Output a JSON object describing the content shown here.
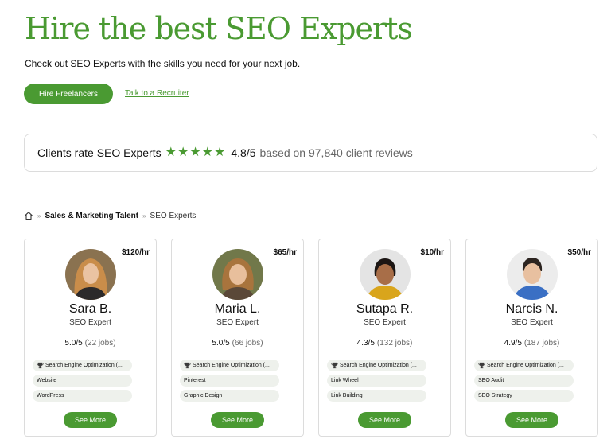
{
  "header": {
    "title": "Hire the best SEO Experts",
    "subtitle": "Check out SEO Experts with the skills you need for your next job.",
    "hire_button": "Hire Freelancers",
    "recruiter_link": "Talk to a Recruiter"
  },
  "rating": {
    "label": "Clients rate SEO Experts",
    "stars": 5,
    "score": "4.8/5",
    "reviews": "based on 97,840 client reviews"
  },
  "breadcrumb": {
    "home_icon": "home-icon",
    "parent": "Sales & Marketing Talent",
    "current": "SEO Experts"
  },
  "freelancers": [
    {
      "rate": "$120/hr",
      "name": "Sara B.",
      "role": "SEO Expert",
      "score": "5.0/5",
      "jobs": "(22 jobs)",
      "skills": [
        "Search Engine Optimization (...",
        "Website",
        "WordPress"
      ],
      "button": "See More",
      "avatar": {
        "bg": "#8a7250",
        "hair": "#c98d4a",
        "skin": "#eac3a2",
        "shirt": "#2c2a2a"
      }
    },
    {
      "rate": "$65/hr",
      "name": "Maria L.",
      "role": "SEO Expert",
      "score": "5.0/5",
      "jobs": "(66 jobs)",
      "skills": [
        "Search Engine Optimization (...",
        "Pinterest",
        "Graphic Design"
      ],
      "button": "See More",
      "avatar": {
        "bg": "#71784a",
        "hair": "#a8743d",
        "skin": "#e8bf9c",
        "shirt": "#5a4838"
      }
    },
    {
      "rate": "$10/hr",
      "name": "Sutapa R.",
      "role": "SEO Expert",
      "score": "4.3/5",
      "jobs": "(132 jobs)",
      "skills": [
        "Search Engine Optimization (...",
        "Link Wheel",
        "Link Building"
      ],
      "button": "See More",
      "avatar": {
        "bg": "#e4e4e4",
        "hair": "#1c1614",
        "skin": "#a86e48",
        "shirt": "#d9a51c"
      }
    },
    {
      "rate": "$50/hr",
      "name": "Narcis N.",
      "role": "SEO Expert",
      "score": "4.9/5",
      "jobs": "(187 jobs)",
      "skills": [
        "Search Engine Optimization (...",
        "SEO Audit",
        "SEO Strategy"
      ],
      "button": "See More",
      "avatar": {
        "bg": "#ececec",
        "hair": "#2c2420",
        "skin": "#e8c0a0",
        "shirt": "#3a6fc4"
      }
    }
  ],
  "colors": {
    "accent": "#4a9a32",
    "pill_bg": "#eef1ec",
    "border": "#dcdcdc"
  }
}
